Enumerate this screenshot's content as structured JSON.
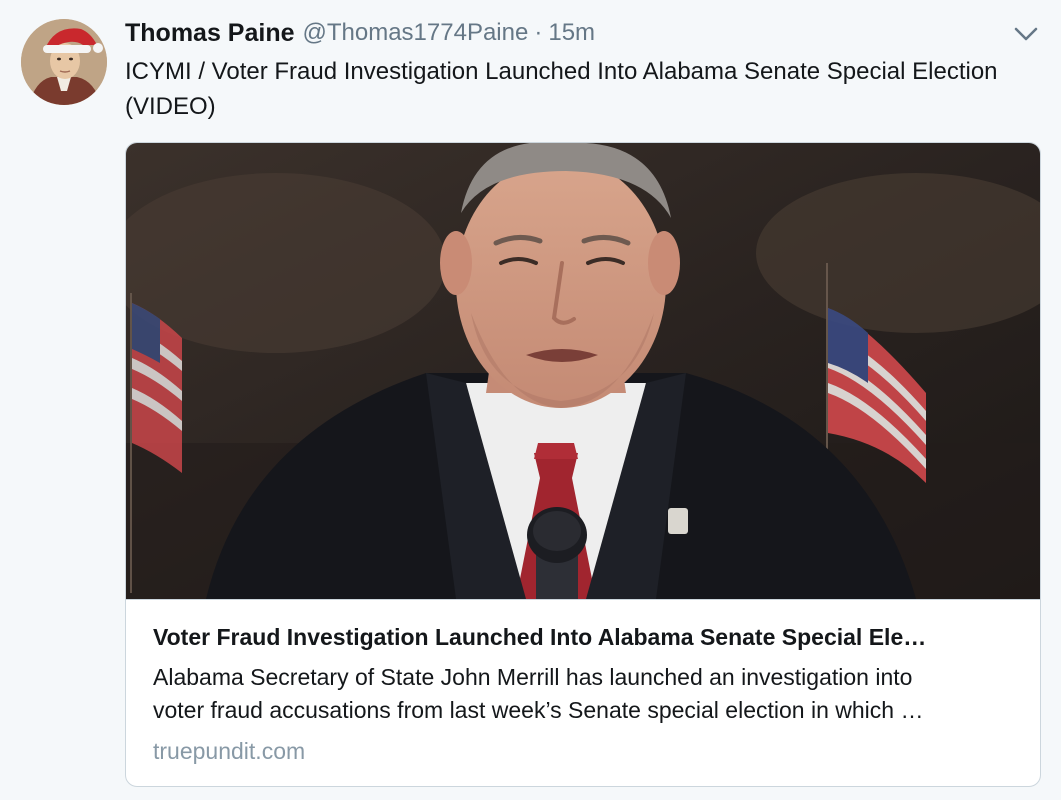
{
  "tweet": {
    "author_name": "Thomas Paine",
    "author_handle": "@Thomas1774Paine",
    "separator": "·",
    "time_ago": "15m",
    "text": "ICYMI / Voter Fraud Investigation Launched Into Alabama Senate Special Election (VIDEO)"
  },
  "card": {
    "title": "Voter Fraud Investigation Launched Into Alabama Senate Special Ele…",
    "description_line1": "Alabama Secretary of State John Merrill has launched an investigation into",
    "description_line2": "voter fraud accusations from last week’s Senate special election in which …",
    "domain": "truepundit.com"
  },
  "icons": {
    "menu": "chevron-down-icon"
  },
  "colors": {
    "background": "#f5f8fa",
    "secondary_text": "#657786",
    "domain_text": "#8899a6",
    "border": "#ccd6dd"
  }
}
